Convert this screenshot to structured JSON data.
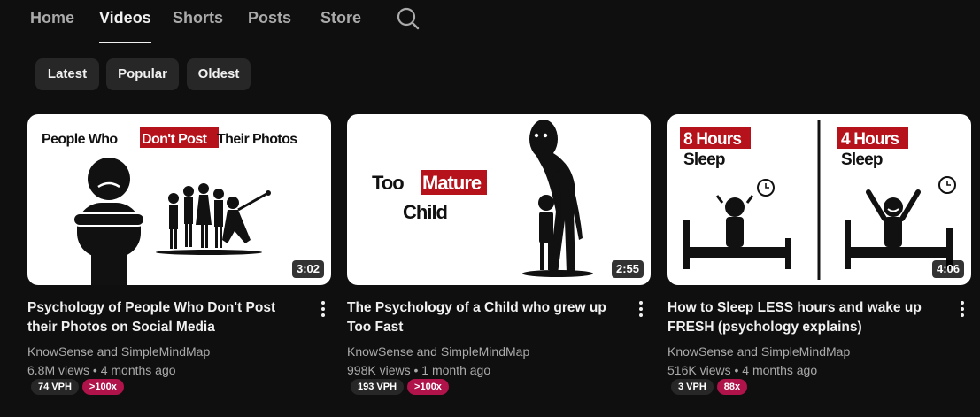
{
  "nav": {
    "tabs": [
      {
        "label": "Home"
      },
      {
        "label": "Videos"
      },
      {
        "label": "Shorts"
      },
      {
        "label": "Posts"
      },
      {
        "label": "Store"
      }
    ],
    "active_tab": "Videos",
    "search_icon": "search-icon"
  },
  "filters": {
    "chips": [
      {
        "label": "Latest"
      },
      {
        "label": "Popular"
      },
      {
        "label": "Oldest"
      }
    ]
  },
  "videos": [
    {
      "title": "Psychology of People Who Don't Post their Photos on Social Media",
      "channel": "KnowSense and SimpleMindMap",
      "meta": "6.8M views • 4 months ago",
      "duration": "3:02",
      "vph": "74 VPH",
      "ratio": ">100x",
      "thumb_text": {
        "a": "People Who ",
        "b": "Don't Post",
        "c": " Their Photos"
      }
    },
    {
      "title": "The Psychology of a Child who grew up Too Fast",
      "channel": "KnowSense and SimpleMindMap",
      "meta": "998K views • 1 month ago",
      "duration": "2:55",
      "vph": "193 VPH",
      "ratio": ">100x",
      "thumb_text": {
        "a": "Too",
        "b": "Mature",
        "c": "Child"
      }
    },
    {
      "title": "How to Sleep LESS hours and wake up FRESH (psychology explains)",
      "channel": "KnowSense and SimpleMindMap",
      "meta": "516K views • 4 months ago",
      "duration": "4:06",
      "vph": "3 VPH",
      "ratio": "88x",
      "thumb_text": {
        "a": "8 Hours",
        "b": "Sleep",
        "c": "4 Hours",
        "d": "Sleep"
      }
    }
  ],
  "colors": {
    "background": "#0f0f0f",
    "chip": "#272727",
    "ratio_badge": "#b0124a",
    "thumb_accent": "#b5121b"
  }
}
